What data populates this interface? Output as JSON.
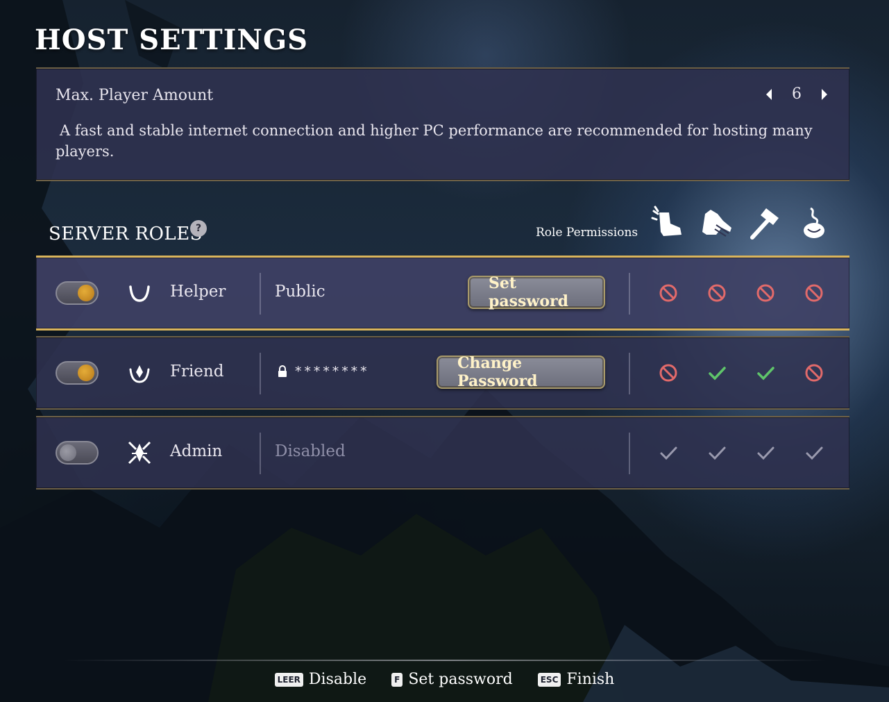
{
  "title": "HOST SETTINGS",
  "player_setting": {
    "label": "Max. Player Amount",
    "value": "6",
    "description": "A fast and stable internet connection and higher PC performance are recommended for hosting many players."
  },
  "server_roles": {
    "title": "SERVER ROLES",
    "help_glyph": "?",
    "permissions_label": "Role Permissions",
    "permission_icons": [
      "boot-icon",
      "glove-icon",
      "hammer-icon",
      "potion-icon"
    ]
  },
  "roles": [
    {
      "name": "Helper",
      "enabled": true,
      "access": "Public",
      "button": "Set password",
      "permissions": [
        "denied",
        "denied",
        "denied",
        "denied"
      ]
    },
    {
      "name": "Friend",
      "enabled": true,
      "password_mask": "********",
      "button": "Change Password",
      "permissions": [
        "denied",
        "allowed",
        "allowed",
        "denied"
      ]
    },
    {
      "name": "Admin",
      "enabled": false,
      "access": "Disabled",
      "permissions": [
        "locked",
        "locked",
        "locked",
        "locked"
      ]
    }
  ],
  "footer": {
    "hints": [
      {
        "key": "LEER",
        "label": "Disable"
      },
      {
        "key": "F",
        "label": "Set password"
      },
      {
        "key": "ESC",
        "label": "Finish"
      }
    ]
  },
  "colors": {
    "accent_gold": "#d9b45c",
    "denied": "#e26a6a",
    "allowed": "#5fc56a",
    "locked": "#9a9aae"
  }
}
